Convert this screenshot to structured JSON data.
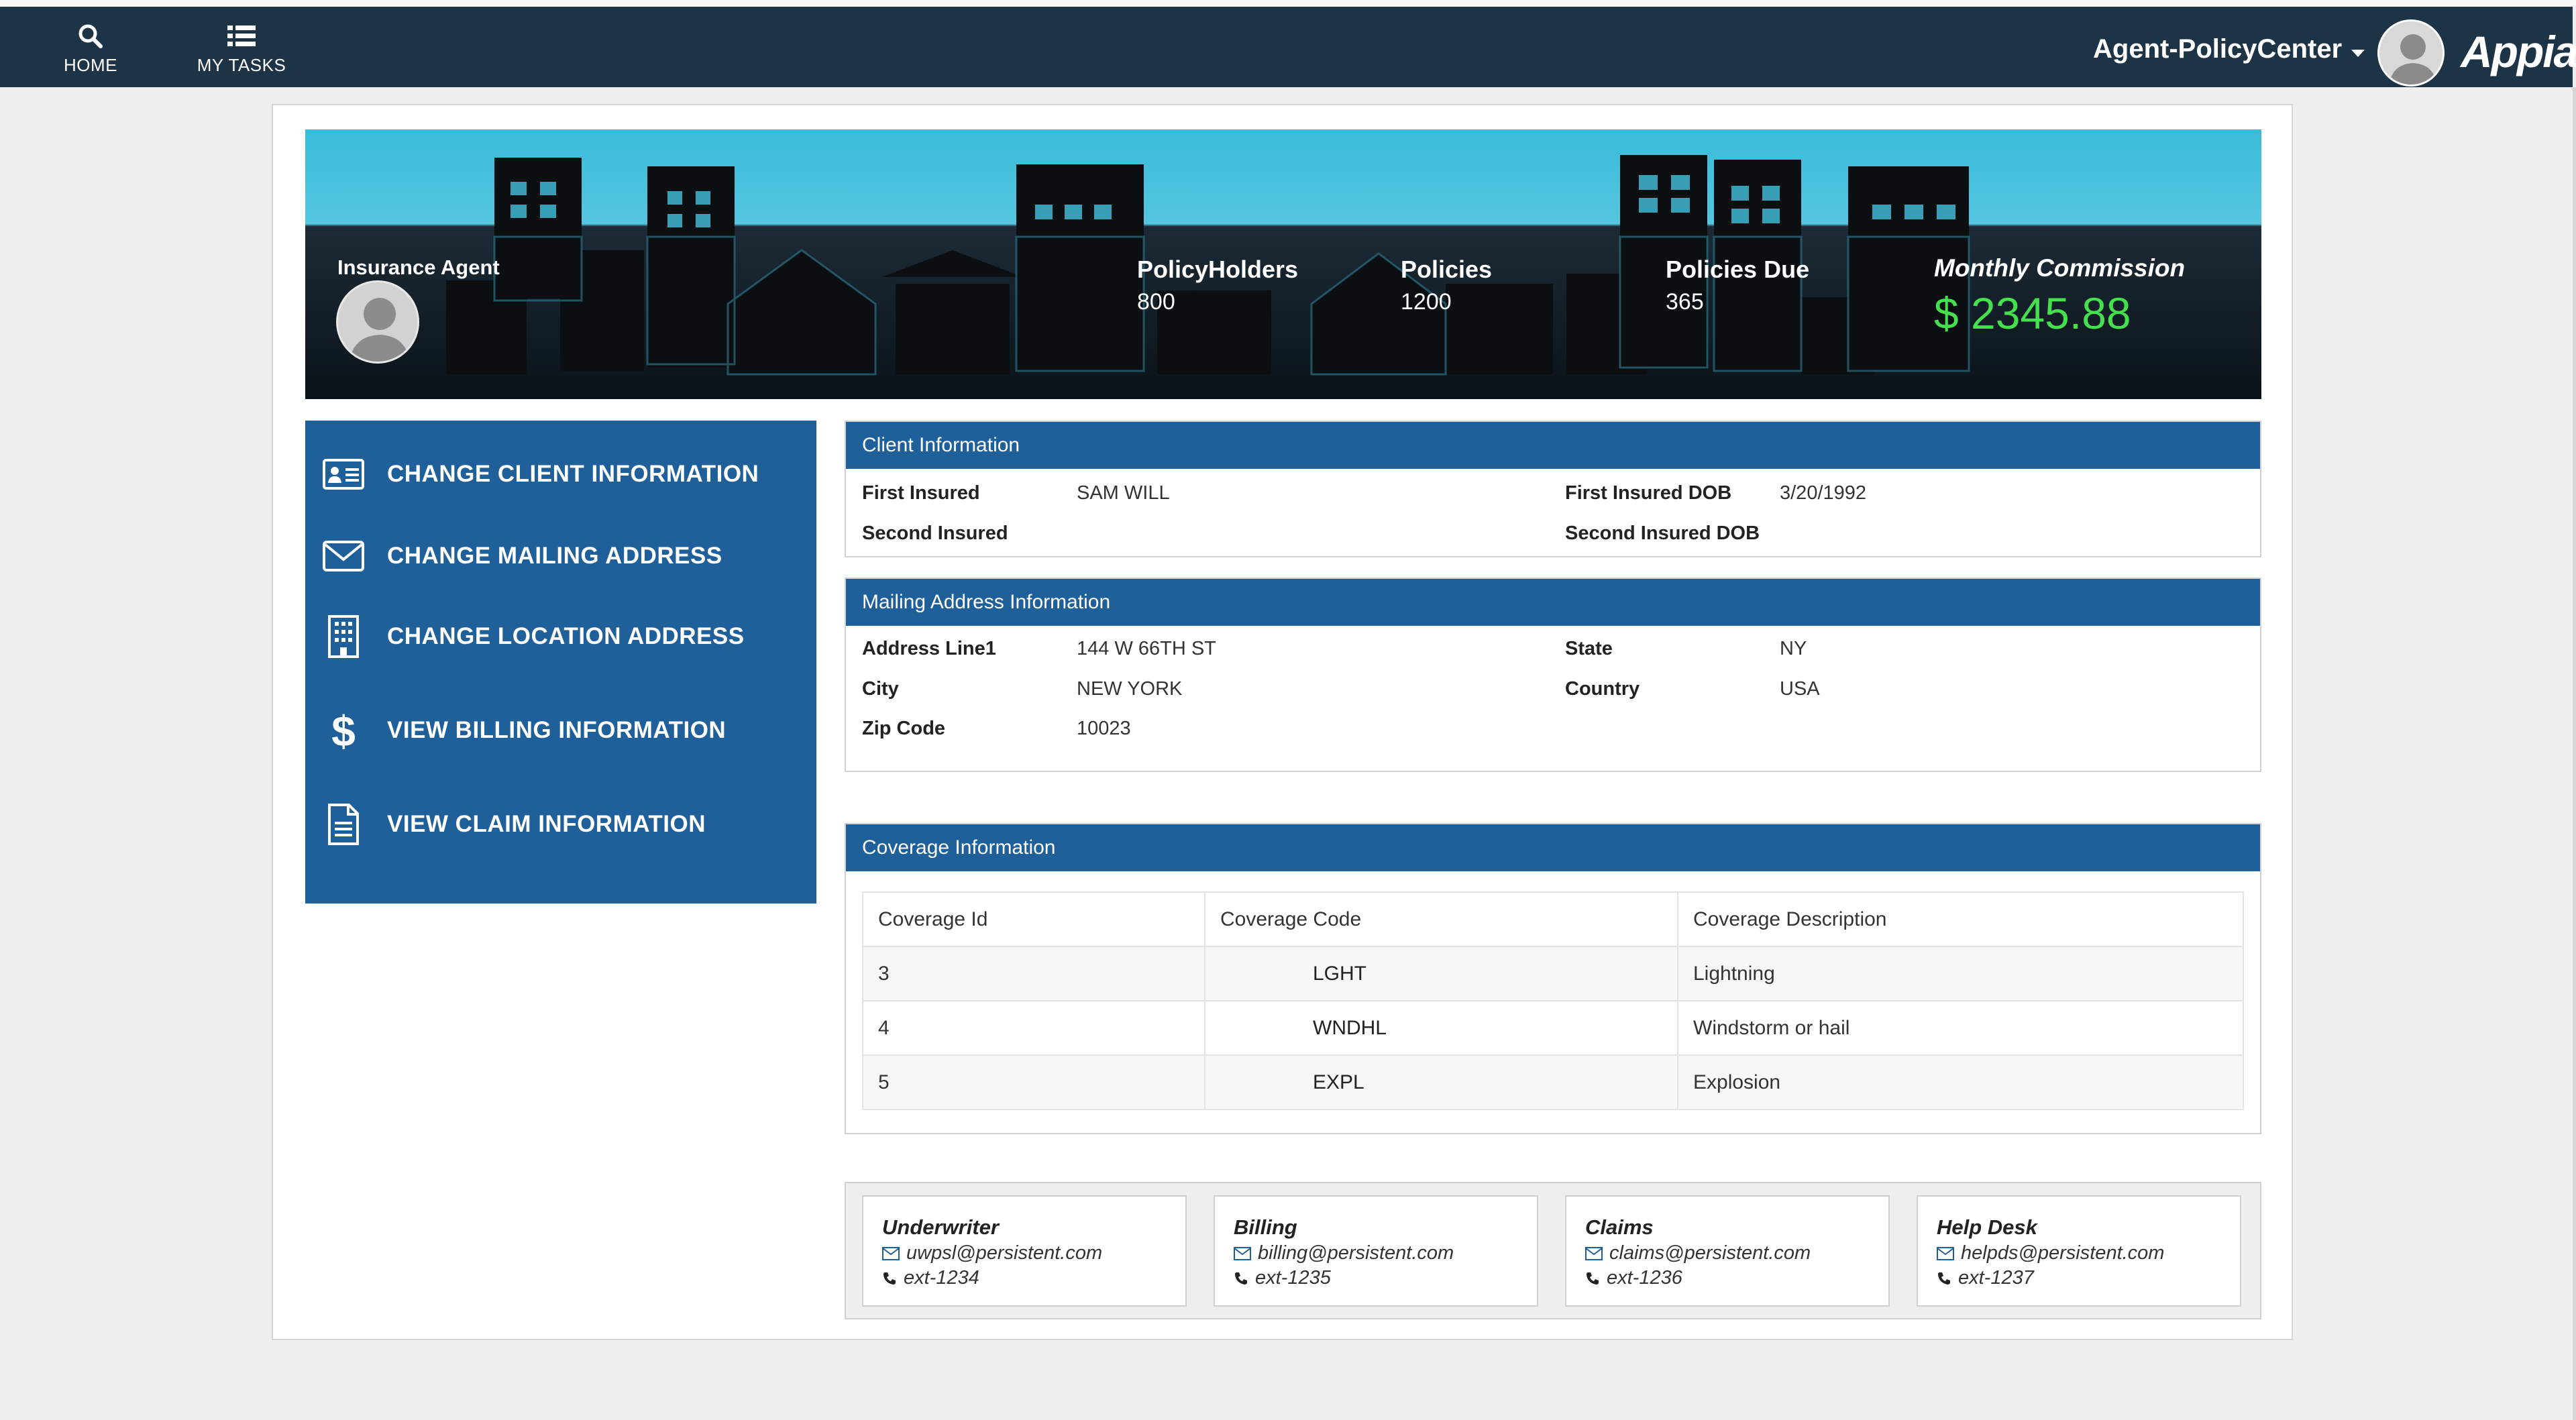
{
  "nav": {
    "home_label": "HOME",
    "tasks_label": "MY TASKS",
    "site_name": "Agent-PolicyCenter",
    "brand": "Appian"
  },
  "banner": {
    "agent_label": "Insurance Agent",
    "stats": [
      {
        "label": "PolicyHolders",
        "value": "800"
      },
      {
        "label": "Policies",
        "value": "1200"
      },
      {
        "label": "Policies Due",
        "value": "365"
      }
    ],
    "commission_label": "Monthly Commission",
    "commission_value": "$ 2345.88"
  },
  "menu": {
    "items": [
      {
        "label": "CHANGE CLIENT INFORMATION",
        "icon": "id-card-icon"
      },
      {
        "label": "CHANGE MAILING ADDRESS",
        "icon": "envelope-icon"
      },
      {
        "label": "CHANGE LOCATION ADDRESS",
        "icon": "building-icon"
      },
      {
        "label": "VIEW BILLING INFORMATION",
        "icon": "dollar-icon"
      },
      {
        "label": "VIEW CLAIM INFORMATION",
        "icon": "document-icon"
      }
    ]
  },
  "client": {
    "title": "Client Information",
    "first_insured_label": "First Insured",
    "first_insured_value": "SAM WILL",
    "second_insured_label": "Second Insured",
    "second_insured_value": "",
    "first_dob_label": "First Insured DOB",
    "first_dob_value": "3/20/1992",
    "second_dob_label": "Second Insured DOB",
    "second_dob_value": ""
  },
  "mailing": {
    "title": "Mailing Address Information",
    "address1_label": "Address Line1",
    "address1_value": "144 W 66TH ST",
    "city_label": "City",
    "city_value": "NEW YORK",
    "zip_label": "Zip Code",
    "zip_value": "10023",
    "state_label": "State",
    "state_value": "NY",
    "country_label": "Country",
    "country_value": "USA"
  },
  "coverage": {
    "title": "Coverage Information",
    "columns": [
      "Coverage Id",
      "Coverage Code",
      "Coverage Description"
    ],
    "rows": [
      [
        "3",
        "LGHT",
        "Lightning"
      ],
      [
        "4",
        "WNDHL",
        "Windstorm or hail"
      ],
      [
        "5",
        "EXPL",
        "Explosion"
      ]
    ]
  },
  "contacts": [
    {
      "title": "Underwriter",
      "email": "uwpsl@persistent.com",
      "phone": "ext-1234"
    },
    {
      "title": "Billing",
      "email": "billing@persistent.com",
      "phone": "ext-1235"
    },
    {
      "title": "Claims",
      "email": "claims@persistent.com",
      "phone": "ext-1236"
    },
    {
      "title": "Help Desk",
      "email": "helpds@persistent.com",
      "phone": "ext-1237"
    }
  ],
  "colors": {
    "nav_bg": "#1d3346",
    "panel_blue": "#1f5f9a",
    "commission_green": "#44e04d",
    "banner_sky": "#39bbd8"
  }
}
